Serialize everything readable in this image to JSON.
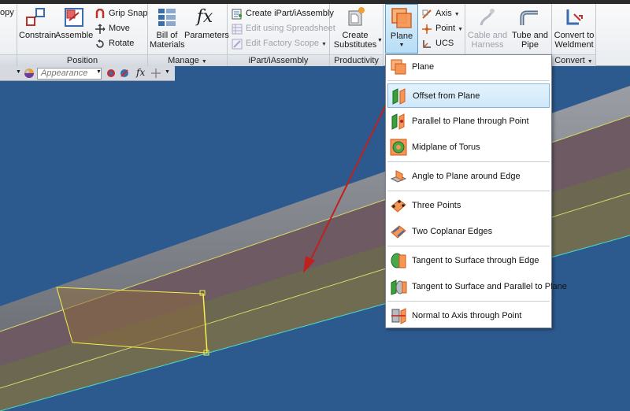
{
  "ribbon": {
    "left_cut_label": "opy",
    "position": {
      "label": "Position",
      "constrain": "Constrain",
      "assemble": "Assemble",
      "grip_snap": "Grip Snap",
      "move": "Move",
      "rotate": "Rotate"
    },
    "manage": {
      "label": "Manage",
      "bom_line1": "Bill of",
      "bom_line2": "Materials",
      "parameters": "Parameters"
    },
    "ipart": {
      "label": "iPart/iAssembly",
      "create": "Create iPart/iAssembly",
      "edit_spreadsheet": "Edit using Spreadsheet",
      "edit_factory": "Edit Factory Scope"
    },
    "productivity": {
      "label": "Productivity",
      "create_line1": "Create",
      "create_line2": "Substitutes"
    },
    "work_features": {
      "plane": "Plane",
      "axis": "Axis",
      "point": "Point",
      "ucs": "UCS"
    },
    "route": {
      "cable_line1": "Cable and",
      "cable_line2": "Harness",
      "tube_line1": "Tube and",
      "tube_line2": "Pipe"
    },
    "convert": {
      "label": "Convert",
      "weldment_line1": "Convert to",
      "weldment_line2": "Weldment"
    }
  },
  "toolbar": {
    "appearance_value": "Appearance"
  },
  "dropdown": {
    "items": [
      {
        "label": "Plane",
        "icon": "plane-icon"
      },
      {
        "label": "Offset from Plane",
        "icon": "offset-plane-icon",
        "highlighted": true
      },
      {
        "label": "Parallel to Plane through Point",
        "icon": "parallel-plane-icon"
      },
      {
        "label": "Midplane of Torus",
        "icon": "torus-icon"
      },
      {
        "label": "Angle to Plane around Edge",
        "icon": "angle-plane-icon"
      },
      {
        "label": "Three Points",
        "icon": "three-points-icon"
      },
      {
        "label": "Two Coplanar Edges",
        "icon": "coplanar-edges-icon"
      },
      {
        "label": "Tangent to Surface through Edge",
        "icon": "tangent-edge-icon"
      },
      {
        "label": "Tangent to Surface and Parallel to Plane",
        "icon": "tangent-parallel-icon"
      },
      {
        "label": "Normal to Axis through Point",
        "icon": "normal-axis-icon"
      }
    ]
  },
  "colors": {
    "viewport_bg": "#2d5a8e",
    "highlight": "#cfe8f9",
    "arrow": "#c0201e",
    "selection": "#f0f050"
  }
}
